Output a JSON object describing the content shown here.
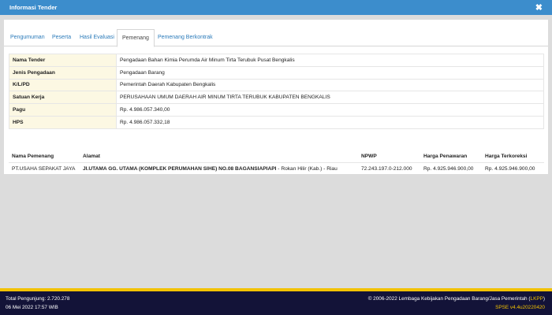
{
  "header": {
    "title": "Informasi Tender",
    "close_icon": "close-icon",
    "close_glyph": "✖"
  },
  "tabs": [
    {
      "label": "Pengumuman",
      "active": false
    },
    {
      "label": "Peserta",
      "active": false
    },
    {
      "label": "Hasil Evaluasi",
      "active": false
    },
    {
      "label": "Pemenang",
      "active": true
    },
    {
      "label": "Pemenang Berkontrak",
      "active": false
    }
  ],
  "info_rows": [
    {
      "label": "Nama Tender",
      "value": "Pengadaan Bahan Kimia Perumda Air Minum Tirta Terubuk Pusat Bengkalis"
    },
    {
      "label": "Jenis Pengadaan",
      "value": "Pengadaan Barang"
    },
    {
      "label": "K/L/PD",
      "value": "Pemerintah Daerah Kabupaten Bengkalis"
    },
    {
      "label": "Satuan Kerja",
      "value": "PERUSAHAAN UMUM DAERAH AIR MINUM TIRTA TERUBUK KABUPATEN BENGKALIS"
    },
    {
      "label": "Pagu",
      "value": "Rp. 4.986.057.340,00"
    },
    {
      "label": "HPS",
      "value": "Rp. 4.986.057.332,18"
    }
  ],
  "winners": {
    "headers": {
      "name": "Nama Pemenang",
      "address": "Alamat",
      "npwp": "NPWP",
      "offer": "Harga Penawaran",
      "corrected": "Harga Terkoreksi"
    },
    "rows": [
      {
        "name": "PT.USAHA SEPAKAT JAYA",
        "address_bold": "Jl.UTAMA GG. UTAMA (KOMPLEK PERUMAHAN SIHE) NO.08 BAGANSIAPIAPI",
        "address_rest": " - Rokan Hilir (Kab.) - Riau",
        "npwp": "72.243.197.0-212.000",
        "offer": "Rp. 4.925.946.900,00",
        "corrected": "Rp. 4.925.946.900,00"
      }
    ]
  },
  "footer": {
    "visitors": "Total Pengunjung: 2.720.278",
    "datetime": "06 Mei 2022 17:57 WIB",
    "copyright": "© 2006-2022 Lembaga Kebijakan Pengadaan Barang/Jasa Pemerintah (",
    "copyright_abbr": "LKPP",
    "copyright_end": ")",
    "version": "SPSE v4.4u20220420"
  },
  "colors": {
    "header_bg": "#3c8dcc",
    "tab_link": "#2b7bba",
    "label_bg": "#fcf8e3",
    "footer_bg": "#131338",
    "footer_accent": "#f2c200"
  }
}
